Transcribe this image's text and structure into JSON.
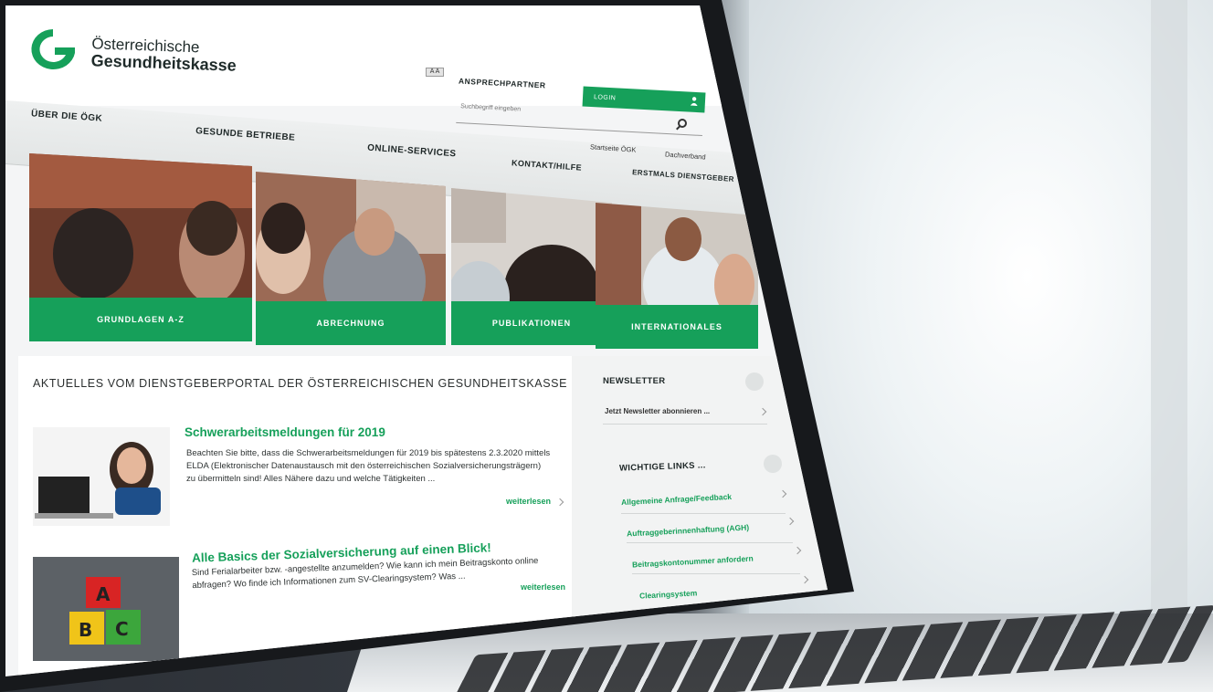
{
  "brand": {
    "line1": "Österreichische",
    "line2": "Gesundheitskasse",
    "green": "#16a05a"
  },
  "header": {
    "lang_badge": "A A",
    "contact": "ANSPRECHPARTNER",
    "search_placeholder": "Suchbegriff eingeben",
    "login": "LOGIN"
  },
  "nav": {
    "items": [
      "ÜBER DIE ÖGK",
      "GESUNDE BETRIEBE",
      "ONLINE-SERVICES",
      "KONTAKT/HILFE",
      "ERSTMALS DIENSTGEBER"
    ],
    "sub_links": [
      "Startseite ÖGK",
      "Dachverband"
    ]
  },
  "tiles": [
    "GRUNDLAGEN A-Z",
    "ABRECHNUNG",
    "PUBLIKATIONEN",
    "INTERNATIONALES"
  ],
  "news": {
    "heading": "AKTUELLES VOM DIENSTGEBERPORTAL DER ÖSTERREICHISCHEN GESUNDHEITSKASSE",
    "articles": [
      {
        "title": "Schwerarbeitsmeldungen für 2019",
        "text": "Beachten Sie bitte, dass die Schwerarbeitsmeldungen für 2019 bis spätestens 2.3.2020 mittels ELDA (Elektronischer Datenaustausch mit den österreichischen Sozialversicherungsträgern) zu übermitteln sind! Alles Nähere dazu und welche Tätigkeiten ...",
        "more": "weiterlesen"
      },
      {
        "title": "Alle Basics der Sozialversicherung auf einen Blick!",
        "text": "Sind Ferialarbeiter bzw. -angestellte anzumelden? Wie kann ich mein Beitragskonto online abfragen? Wo finde ich Informationen zum SV-Clearingsystem? Was ...",
        "more": "weiterlesen"
      }
    ]
  },
  "sidebar": {
    "newsletter_title": "NEWSLETTER",
    "newsletter_link": "Jetzt Newsletter abonnieren ...",
    "links_title": "WICHTIGE LINKS ...",
    "links": [
      "Allgemeine Anfrage/Feedback",
      "Auftraggeberinnenhaftung (AGH)",
      "Beitragskontonummer anfordern",
      "Clearingsystem"
    ]
  }
}
